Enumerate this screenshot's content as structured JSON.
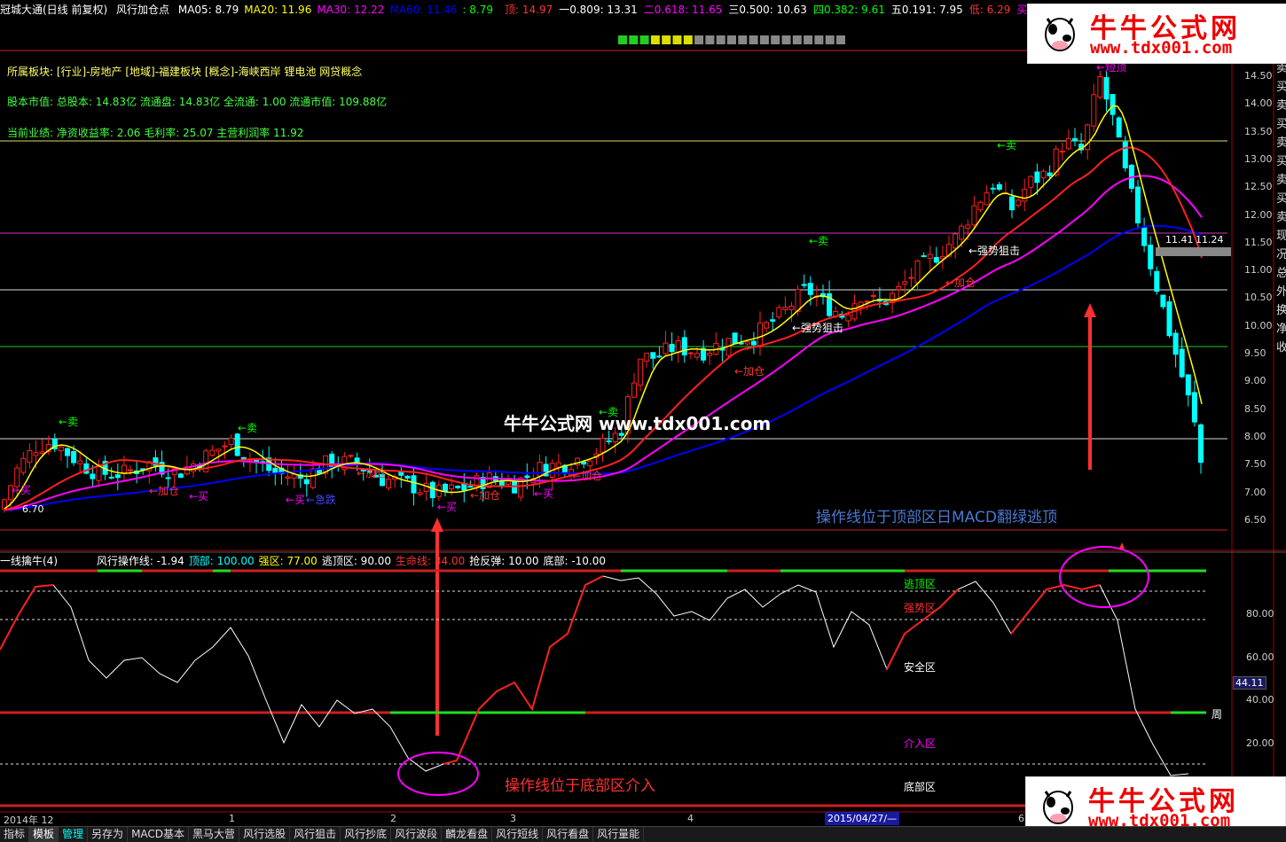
{
  "header": {
    "stock": "冠城大通(日线 前复权)",
    "indicator": "风行加仓点",
    "ma": [
      {
        "label": "MA05: 8.79",
        "color": "#ffffff"
      },
      {
        "label": "MA20: 11.96",
        "color": "#ffff00"
      },
      {
        "label": "MA30: 12.22",
        "color": "#ff00ff"
      },
      {
        "label": "MA60: 11.46",
        "color": "#0000ff"
      },
      {
        "label": ": 8.79",
        "color": "#00ff00"
      }
    ],
    "fib": [
      {
        "label": "顶: 14.97",
        "color": "#ff3333"
      },
      {
        "label": "一0.809: 13.31",
        "color": "#ffffff"
      },
      {
        "label": "二0.618: 11.65",
        "color": "#ff00ff"
      },
      {
        "label": "三0.500: 10.63",
        "color": "#ffffff"
      },
      {
        "label": "四0.382: 9.61",
        "color": "#00ff00"
      },
      {
        "label": "五0.191: 7.95",
        "color": "#ffffff"
      },
      {
        "label": "低: 6.29",
        "color": "#ff3333"
      },
      {
        "label": "买卖比: 0.46",
        "color": "#ff00ff"
      }
    ]
  },
  "info": {
    "sector": "所属板块: [行业]-房地产 [地域]-福建板块 [概念]-海峡西岸 锂电池 网贷概念",
    "shares": "股本市值: 总股本: 14.83亿 流通盘: 14.83亿 全流通: 1.00 流通市值: 109.88亿",
    "perf": "当前业绩: 净资收益率: 2.06 毛利率: 25.07 主营利润率 11.92"
  },
  "price_axis": [
    "14.50",
    "14.00",
    "13.50",
    "13.00",
    "12.50",
    "12.00",
    "11.50",
    "11.00",
    "10.50",
    "10.00",
    "9.50",
    "9.00",
    "8.50",
    "8.00",
    "7.50",
    "7.00",
    "6.50"
  ],
  "right_edge_chars": [
    "趋",
    "势",
    "买",
    "卖",
    "买",
    "卖",
    "买",
    "卖",
    "买",
    "卖",
    "买",
    "卖",
    "现",
    "况",
    "总",
    "外",
    "换",
    "净",
    "收"
  ],
  "chart_labels": {
    "low_price": "6.70",
    "cur_left": "11.41",
    "cur_right": "11.24",
    "signals": [
      {
        "text": "←卖",
        "color": "#00ff00"
      },
      {
        "text": "←卖",
        "color": "#00ff00"
      },
      {
        "text": "←卖",
        "color": "#00ff00"
      },
      {
        "text": "←卖",
        "color": "#00ff00"
      },
      {
        "text": "←卖",
        "color": "#00ff00"
      },
      {
        "text": "←买",
        "color": "#ff00ff"
      },
      {
        "text": "←买",
        "color": "#ff00ff"
      },
      {
        "text": "←买",
        "color": "#ff00ff"
      },
      {
        "text": "←买",
        "color": "#ff00ff"
      },
      {
        "text": "←买",
        "color": "#ff00ff"
      },
      {
        "text": "←加仓",
        "color": "#ff3333"
      },
      {
        "text": "←加仓",
        "color": "#ff3333"
      },
      {
        "text": "←加仓",
        "color": "#ff3333"
      },
      {
        "text": "←加仓",
        "color": "#ff3333"
      },
      {
        "text": "←加仓",
        "color": "#ff3333"
      },
      {
        "text": "←加仓",
        "color": "#ff3333"
      },
      {
        "text": "←强势狙击",
        "color": "#ffffff"
      },
      {
        "text": "←强势狙击",
        "color": "#ffffff"
      },
      {
        "text": "←急跌",
        "color": "#4444ff"
      },
      {
        "text": "←短顶",
        "color": "#ff00ff"
      }
    ]
  },
  "watermark": "牛牛公式网 www.tdx001.com",
  "notes": {
    "top": "操作线位于顶部区日MACD翻绿逃顶",
    "bottom": "操作线位于底部区介入"
  },
  "indicator_panel": {
    "name": "一线擒牛(4)",
    "params": [
      {
        "label": "风行操作线: -1.94",
        "color": "#ffffff"
      },
      {
        "label": "顶部: 100.00",
        "color": "#00ffff"
      },
      {
        "label": "强区: 77.00",
        "color": "#ffff00"
      },
      {
        "label": "逃顶区: 90.00",
        "color": "#ffffff"
      },
      {
        "label": "生命线: 34.00",
        "color": "#ff3333"
      },
      {
        "label": "抢反弹: 10.00",
        "color": "#ffffff"
      },
      {
        "label": "底部: -10.00",
        "color": "#ffffff"
      }
    ],
    "zones": {
      "escape": "逃顶区",
      "strong": "强势区",
      "safe": "安全区",
      "entry": "介入区",
      "bottom": "底部区"
    },
    "axis": [
      "80.00",
      "60.00",
      "40.00",
      "20.00"
    ],
    "current": "44.11",
    "week_label": "周"
  },
  "date_axis": {
    "labels": [
      "2014年 12",
      "1",
      "2",
      "3",
      "4",
      "5",
      "6"
    ],
    "selected": "2015/04/27/—"
  },
  "tabs": [
    "指标",
    "模板",
    "管理",
    "另存为",
    "MACD基本",
    "黑马大营",
    "风行选股",
    "风行狙击",
    "风行抄底",
    "风行波段",
    "麟龙看盘",
    "风行短线",
    "风行看盘",
    "风行量能"
  ],
  "active_tab": "模板",
  "current_tab": "管理",
  "logo": {
    "name": "牛牛公式网",
    "url": "www.tdx001.com"
  },
  "colors": {
    "up": "#ff2020",
    "down": "#00ffff",
    "ma5": "#ffff00",
    "ma10": "#ff2020",
    "ma30": "#ff00ff",
    "ma60": "#0000ff"
  }
}
